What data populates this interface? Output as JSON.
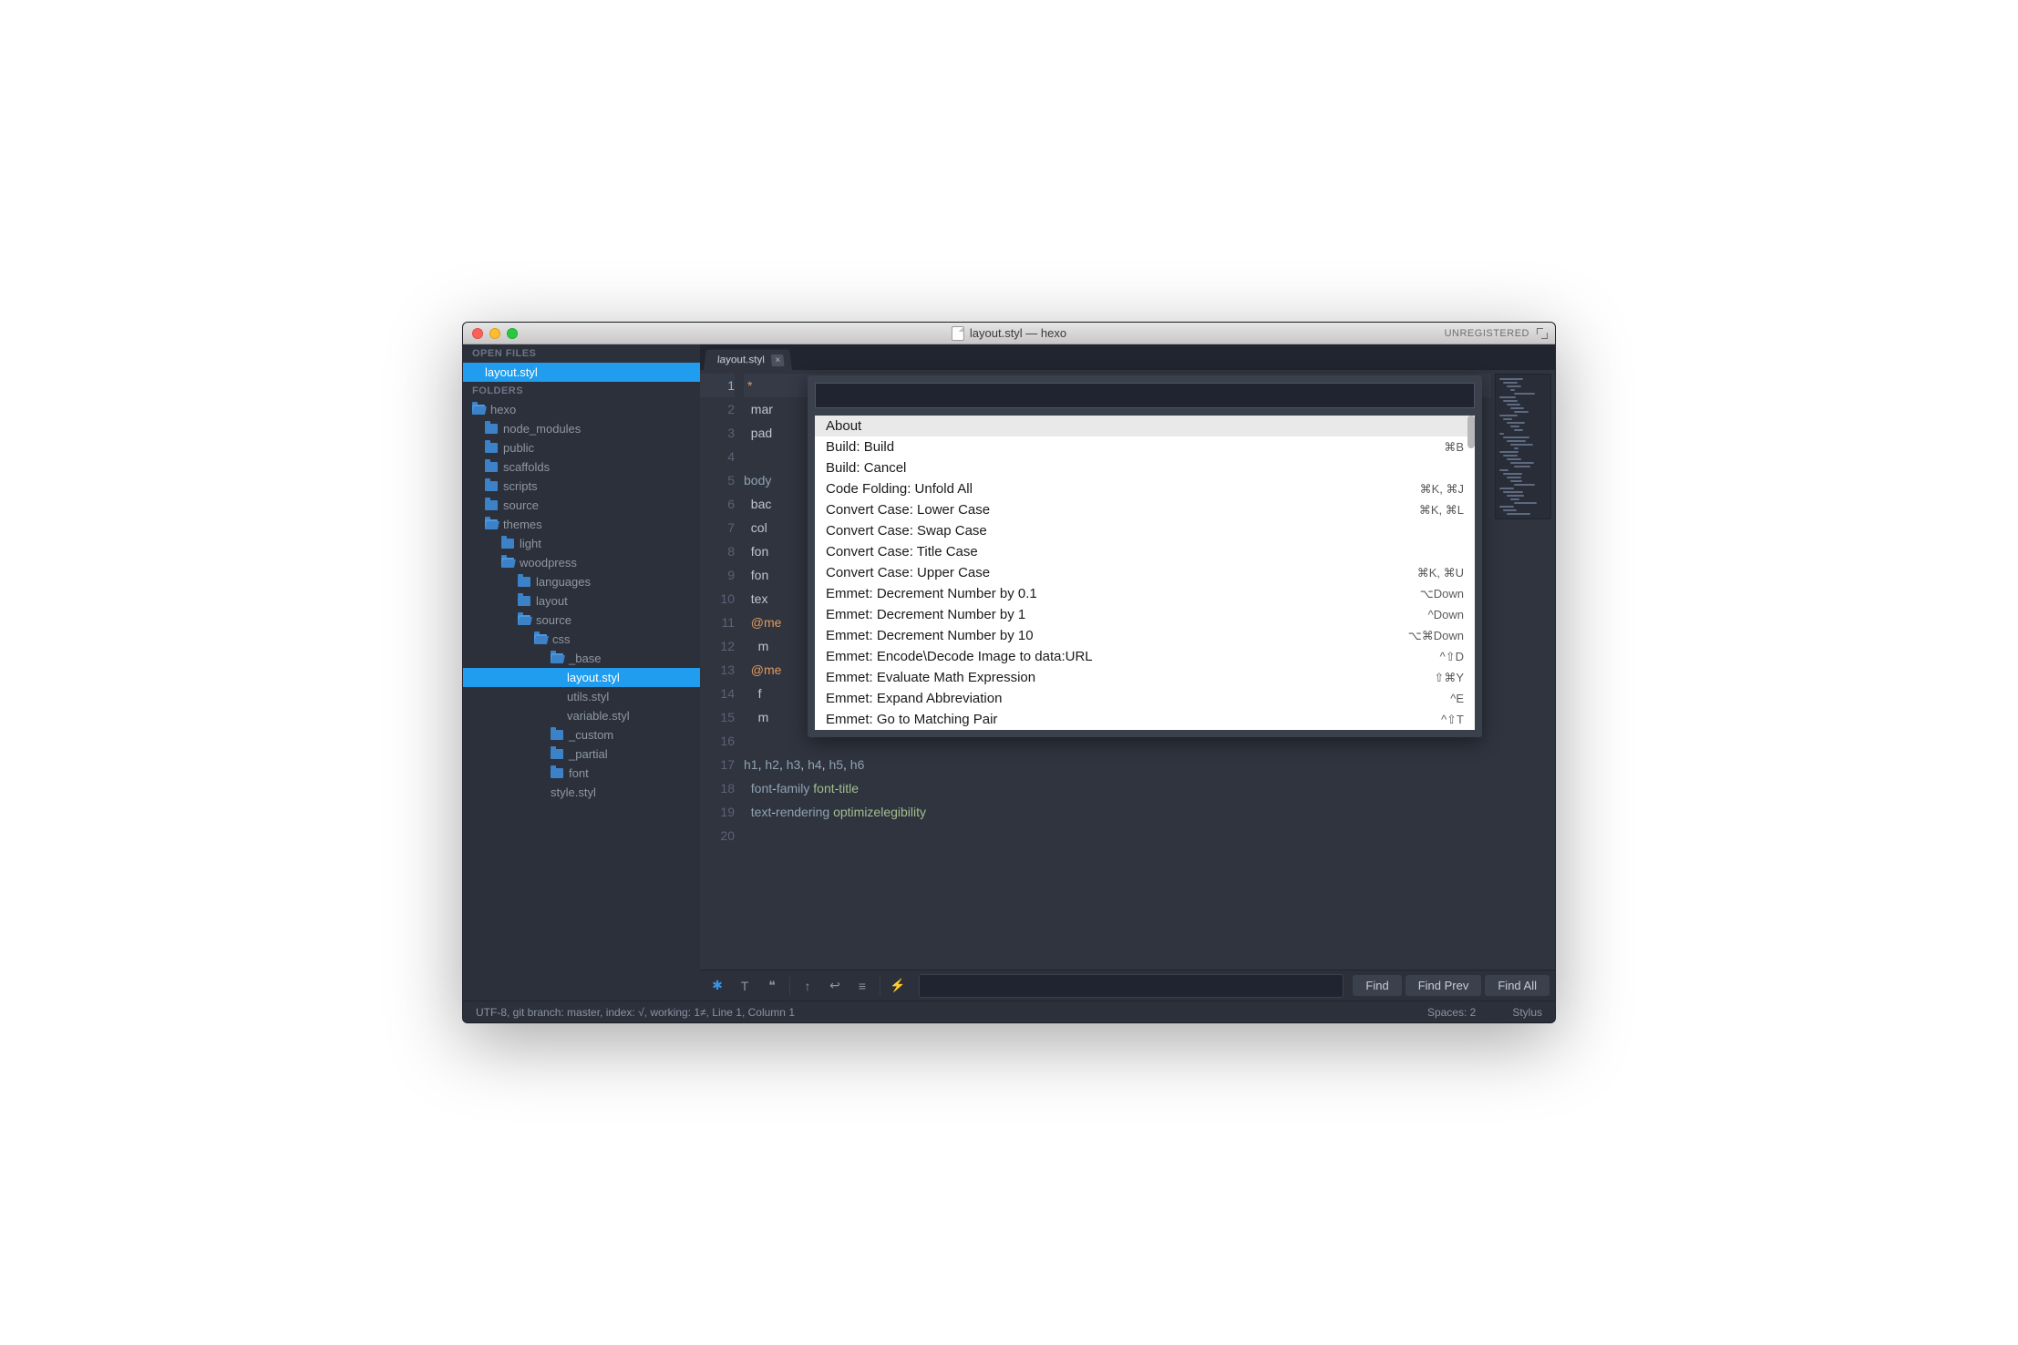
{
  "titlebar": {
    "title": "layout.styl — hexo",
    "unregistered": "UNREGISTERED"
  },
  "sidebar": {
    "openFilesHeader": "OPEN FILES",
    "openFiles": [
      {
        "name": "layout.styl"
      }
    ],
    "foldersHeader": "FOLDERS",
    "tree": [
      {
        "name": "hexo",
        "indent": 0,
        "open": true
      },
      {
        "name": "node_modules",
        "indent": 1,
        "open": false
      },
      {
        "name": "public",
        "indent": 1,
        "open": false
      },
      {
        "name": "scaffolds",
        "indent": 1,
        "open": false
      },
      {
        "name": "scripts",
        "indent": 1,
        "open": false
      },
      {
        "name": "source",
        "indent": 1,
        "open": false
      },
      {
        "name": "themes",
        "indent": 1,
        "open": true
      },
      {
        "name": "light",
        "indent": 2,
        "open": false
      },
      {
        "name": "woodpress",
        "indent": 2,
        "open": true
      },
      {
        "name": "languages",
        "indent": 3,
        "open": false
      },
      {
        "name": "layout",
        "indent": 3,
        "open": false
      },
      {
        "name": "source",
        "indent": 3,
        "open": true
      },
      {
        "name": "css",
        "indent": 4,
        "open": true
      },
      {
        "name": "_base",
        "indent": 5,
        "open": true
      },
      {
        "name": "layout.styl",
        "indent": 6,
        "file": true,
        "selected": true
      },
      {
        "name": "utils.styl",
        "indent": 6,
        "file": true
      },
      {
        "name": "variable.styl",
        "indent": 6,
        "file": true
      },
      {
        "name": "_custom",
        "indent": 5,
        "open": false
      },
      {
        "name": "_partial",
        "indent": 5,
        "open": false
      },
      {
        "name": "font",
        "indent": 5,
        "open": false
      },
      {
        "name": "style.styl",
        "indent": 5,
        "file": true
      }
    ]
  },
  "tab": {
    "label": "layout.styl"
  },
  "code": {
    "lines": [
      {
        "n": 1,
        "parts": [
          {
            "t": "*",
            "c": "star"
          }
        ],
        "active": true
      },
      {
        "n": 2,
        "parts": [
          {
            "t": "  ",
            "c": ""
          },
          {
            "t": "mar",
            "c": "prop"
          }
        ]
      },
      {
        "n": 3,
        "parts": [
          {
            "t": "  ",
            "c": ""
          },
          {
            "t": "pad",
            "c": "prop"
          }
        ]
      },
      {
        "n": 4,
        "parts": []
      },
      {
        "n": 5,
        "parts": [
          {
            "t": "body",
            "c": "sel-css"
          }
        ]
      },
      {
        "n": 6,
        "parts": [
          {
            "t": "  ",
            "c": ""
          },
          {
            "t": "bac",
            "c": "prop"
          }
        ]
      },
      {
        "n": 7,
        "parts": [
          {
            "t": "  ",
            "c": ""
          },
          {
            "t": "col",
            "c": "prop"
          }
        ]
      },
      {
        "n": 8,
        "parts": [
          {
            "t": "  ",
            "c": ""
          },
          {
            "t": "fon",
            "c": "prop"
          }
        ]
      },
      {
        "n": 9,
        "parts": [
          {
            "t": "  ",
            "c": ""
          },
          {
            "t": "fon",
            "c": "prop"
          }
        ]
      },
      {
        "n": 10,
        "parts": [
          {
            "t": "  ",
            "c": ""
          },
          {
            "t": "tex",
            "c": "prop"
          }
        ]
      },
      {
        "n": 11,
        "parts": [
          {
            "t": "  ",
            "c": ""
          },
          {
            "t": "@me",
            "c": "at"
          }
        ]
      },
      {
        "n": 12,
        "parts": [
          {
            "t": "    ",
            "c": ""
          },
          {
            "t": "m",
            "c": "prop"
          }
        ]
      },
      {
        "n": 13,
        "parts": [
          {
            "t": "  ",
            "c": ""
          },
          {
            "t": "@me",
            "c": "at"
          }
        ]
      },
      {
        "n": 14,
        "parts": [
          {
            "t": "    ",
            "c": ""
          },
          {
            "t": "f",
            "c": "prop"
          }
        ]
      },
      {
        "n": 15,
        "parts": [
          {
            "t": "    ",
            "c": ""
          },
          {
            "t": "m",
            "c": "prop"
          }
        ]
      },
      {
        "n": 16,
        "parts": []
      },
      {
        "n": 17,
        "parts": [
          {
            "t": "h1",
            "c": "sel-css"
          },
          {
            "t": ", ",
            "c": "punc"
          },
          {
            "t": "h2",
            "c": "sel-css"
          },
          {
            "t": ", ",
            "c": "punc"
          },
          {
            "t": "h3",
            "c": "sel-css"
          },
          {
            "t": ", ",
            "c": "punc"
          },
          {
            "t": "h4",
            "c": "sel-css"
          },
          {
            "t": ", ",
            "c": "punc"
          },
          {
            "t": "h5",
            "c": "sel-css"
          },
          {
            "t": ", ",
            "c": "punc"
          },
          {
            "t": "h6",
            "c": "sel-css"
          }
        ]
      },
      {
        "n": 18,
        "parts": [
          {
            "t": "  ",
            "c": ""
          },
          {
            "t": "font",
            "c": "kw"
          },
          {
            "t": "-",
            "c": "dash"
          },
          {
            "t": "family",
            "c": "kw"
          },
          {
            "t": " ",
            "c": ""
          },
          {
            "t": "font",
            "c": "val"
          },
          {
            "t": "-",
            "c": "dash"
          },
          {
            "t": "title",
            "c": "val"
          }
        ]
      },
      {
        "n": 19,
        "parts": [
          {
            "t": "  ",
            "c": ""
          },
          {
            "t": "text",
            "c": "kw"
          },
          {
            "t": "-",
            "c": "dash"
          },
          {
            "t": "rendering",
            "c": "kw"
          },
          {
            "t": " ",
            "c": ""
          },
          {
            "t": "optimizelegibility",
            "c": "val"
          }
        ]
      },
      {
        "n": 20,
        "parts": []
      }
    ]
  },
  "palette": {
    "input": "",
    "items": [
      {
        "label": "About",
        "shortcut": "",
        "selected": true
      },
      {
        "label": "Build: Build",
        "shortcut": "⌘B"
      },
      {
        "label": "Build: Cancel",
        "shortcut": ""
      },
      {
        "label": "Code Folding: Unfold All",
        "shortcut": "⌘K, ⌘J"
      },
      {
        "label": "Convert Case: Lower Case",
        "shortcut": "⌘K, ⌘L"
      },
      {
        "label": "Convert Case: Swap Case",
        "shortcut": ""
      },
      {
        "label": "Convert Case: Title Case",
        "shortcut": ""
      },
      {
        "label": "Convert Case: Upper Case",
        "shortcut": "⌘K, ⌘U"
      },
      {
        "label": "Emmet: Decrement Number by 0.1",
        "shortcut": "⌥Down"
      },
      {
        "label": "Emmet: Decrement Number by 1",
        "shortcut": "^Down"
      },
      {
        "label": "Emmet: Decrement Number by 10",
        "shortcut": "⌥⌘Down"
      },
      {
        "label": "Emmet: Encode\\Decode Image to data:URL",
        "shortcut": "^⇧D"
      },
      {
        "label": "Emmet: Evaluate Math Expression",
        "shortcut": "⇧⌘Y"
      },
      {
        "label": "Emmet: Expand Abbreviation",
        "shortcut": "^E"
      },
      {
        "label": "Emmet: Go to Matching Pair",
        "shortcut": "^⇧T"
      }
    ]
  },
  "findbar": {
    "find": "Find",
    "findPrev": "Find Prev",
    "findAll": "Find All"
  },
  "statusbar": {
    "left": "UTF-8, git branch: master, index: √, working: 1≠, Line 1, Column 1",
    "spaces": "Spaces: 2",
    "syntax": "Stylus"
  }
}
